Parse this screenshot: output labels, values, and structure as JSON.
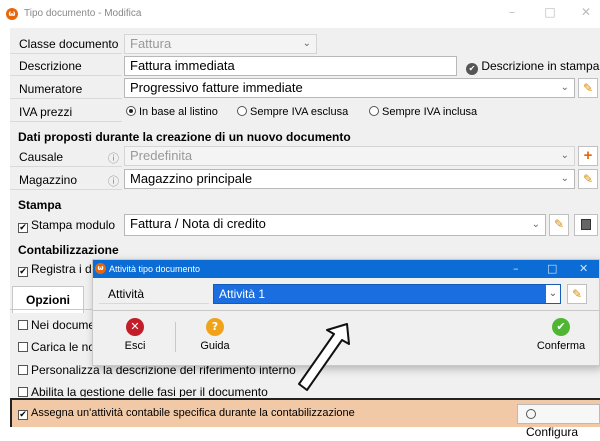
{
  "window": {
    "title": "Tipo documento - Modifica",
    "controls": [
      "–",
      "□",
      "✕"
    ]
  },
  "form": {
    "classe": {
      "label": "Classe documento",
      "value": "Fattura"
    },
    "descrizione": {
      "label": "Descrizione",
      "value": "Fattura immediata",
      "stampa_label": "Descrizione in stampa"
    },
    "numeratore": {
      "label": "Numeratore",
      "value": "Progressivo fatture immediate"
    },
    "iva": {
      "label": "IVA prezzi",
      "options": [
        "In base al listino",
        "Sempre IVA esclusa",
        "Sempre IVA inclusa"
      ],
      "selected": "In base al listino"
    },
    "dati_section": "Dati proposti durante la creazione di un nuovo documento",
    "causale": {
      "label": "Causale",
      "value": "Predefinita"
    },
    "magazzino": {
      "label": "Magazzino",
      "value": "Magazzino principale"
    },
    "stampa_section": "Stampa",
    "stampa_modulo": {
      "label": "Stampa modulo",
      "value": "Fattura / Nota di credito"
    },
    "contab_section": "Contabilizzazione",
    "registra_label": "Registra i doc",
    "tab_opzioni": "Opzioni",
    "options": [
      "Nei documen",
      "Carica le nota",
      "Personalizza la descrizione del riferimento interno",
      "Abilita la gestione delle fasi per il documento"
    ],
    "assegna": {
      "label": "Assegna un'attività contabile specifica durante la contabilizzazione",
      "button": "Configura"
    }
  },
  "dialog": {
    "title": "Attività tipo documento",
    "attivita_label": "Attività",
    "attivita_value": "Attività 1",
    "buttons": {
      "esci": "Esci",
      "guida": "Guida",
      "conferma": "Conferma"
    }
  },
  "icons": {
    "info": "ⓘ",
    "pencil": "✎",
    "plus": "+",
    "chevron": "⌄",
    "check": "✔",
    "close": "✕",
    "question": "?"
  },
  "colors": {
    "accent": "#0a6cd4",
    "brand": "#e8650a",
    "highlight": "#f2c9a6"
  }
}
